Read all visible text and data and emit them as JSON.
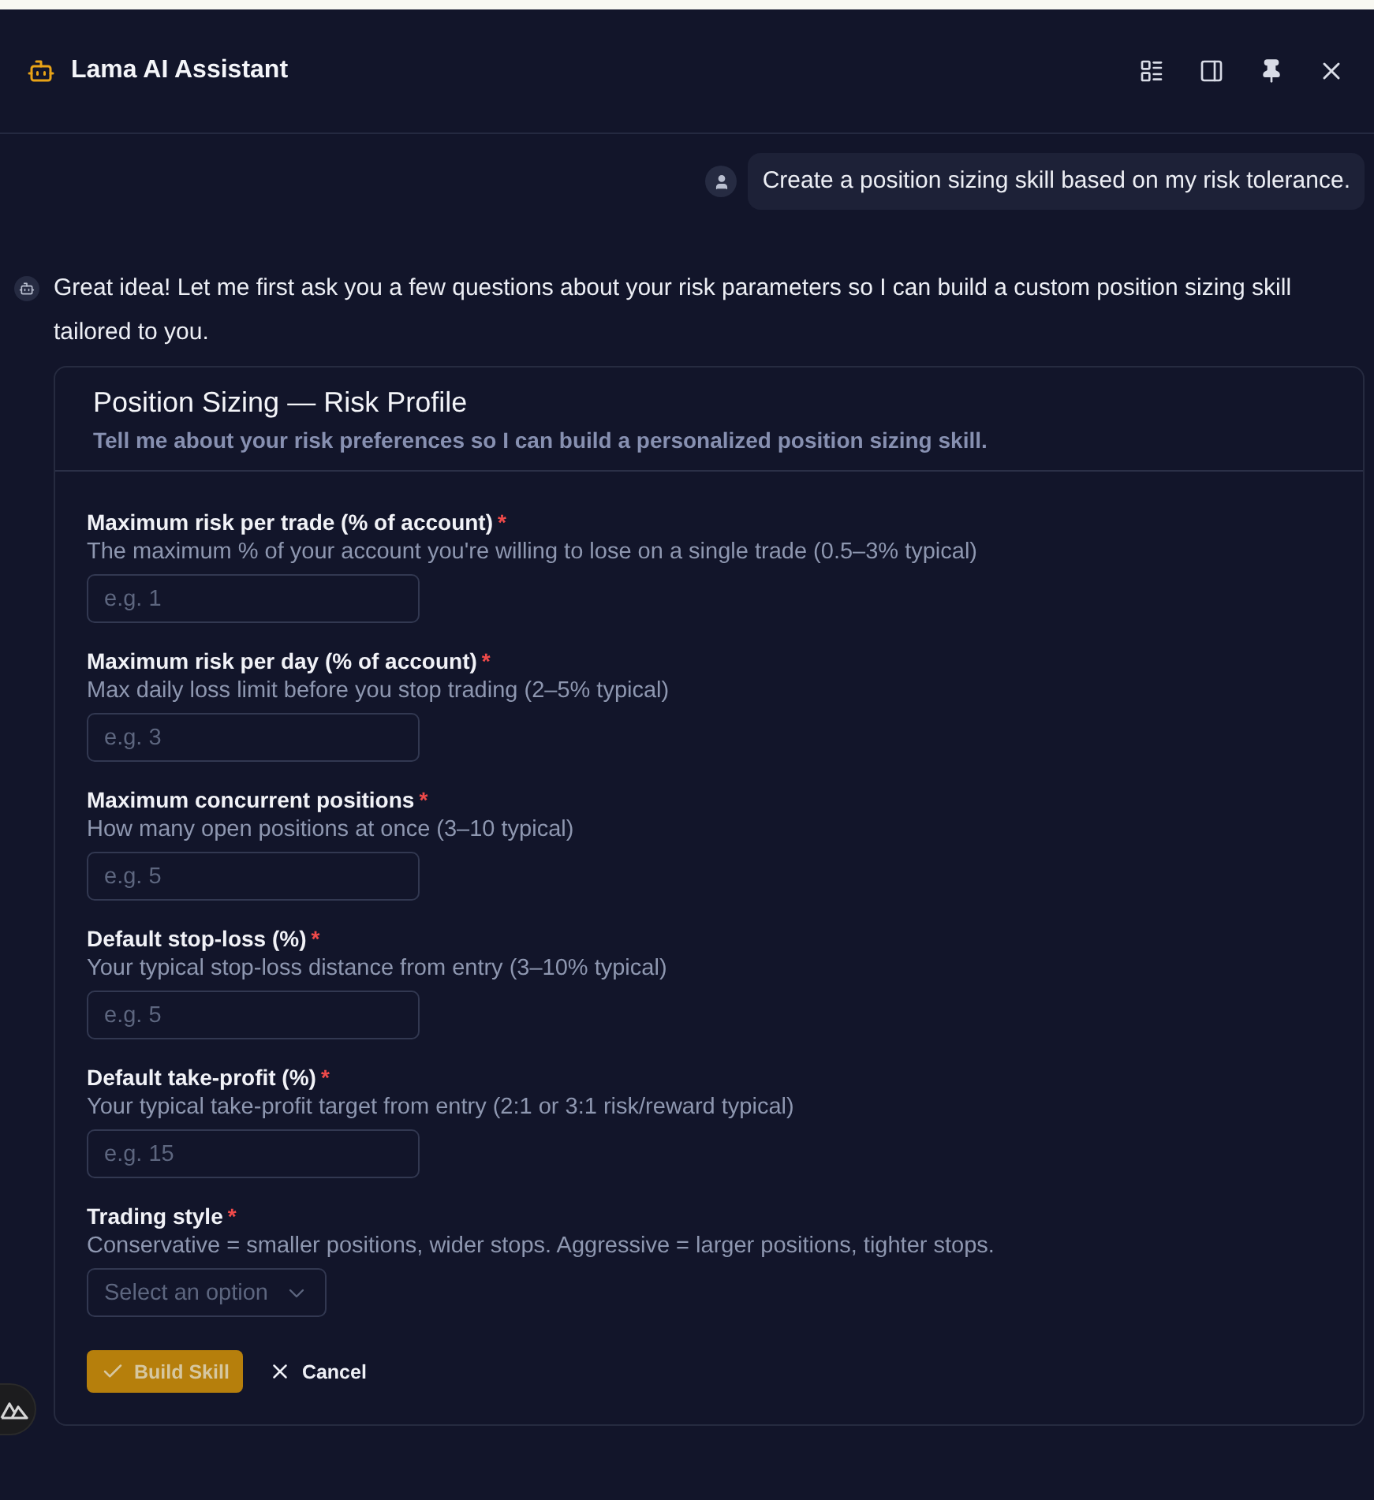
{
  "header": {
    "title": "Lama AI Assistant"
  },
  "messages": [
    {
      "kind": "user",
      "text": "Create a position sizing skill based on my risk tolerance."
    },
    {
      "kind": "assistant",
      "text": "Great idea! Let me first ask you a few questions about your risk parameters so I can build a custom position sizing skill tailored to you."
    }
  ],
  "form": {
    "title": "Position Sizing — Risk Profile",
    "subtitle": "Tell me about your risk preferences so I can build a personalized position sizing skill.",
    "fields": [
      {
        "kind": "input",
        "label": "Maximum risk per trade (% of account)",
        "marker": "*",
        "description": "The maximum % of your account you're willing to lose on a single trade (0.5–3% typical)",
        "placeholder": "e.g. 1"
      },
      {
        "kind": "input",
        "label": "Maximum risk per day (% of account)",
        "marker": "*",
        "description": "Max daily loss limit before you stop trading (2–5% typical)",
        "placeholder": "e.g. 3"
      },
      {
        "kind": "input",
        "label": "Maximum concurrent positions",
        "marker": "*",
        "description": "How many open positions at once (3–10 typical)",
        "placeholder": "e.g. 5"
      },
      {
        "kind": "input",
        "label": "Default stop-loss (%)",
        "marker": "*",
        "description": "Your typical stop-loss distance from entry (3–10% typical)",
        "placeholder": "e.g. 5"
      },
      {
        "kind": "input",
        "label": "Default take-profit (%)",
        "marker": "*",
        "description": "Your typical take-profit target from entry (2:1 or 3:1 risk/reward typical)",
        "placeholder": "e.g. 15"
      },
      {
        "kind": "select",
        "label": "Trading style",
        "marker": "*",
        "description": "Conservative = smaller positions, wider stops. Aggressive = larger positions, tighter stops.",
        "placeholder": "Select an option"
      }
    ],
    "actions": [
      {
        "kind": "primary",
        "label": "Build Skill",
        "disabled": true
      },
      {
        "kind": "cancel",
        "label": "Cancel",
        "disabled": false
      }
    ]
  }
}
